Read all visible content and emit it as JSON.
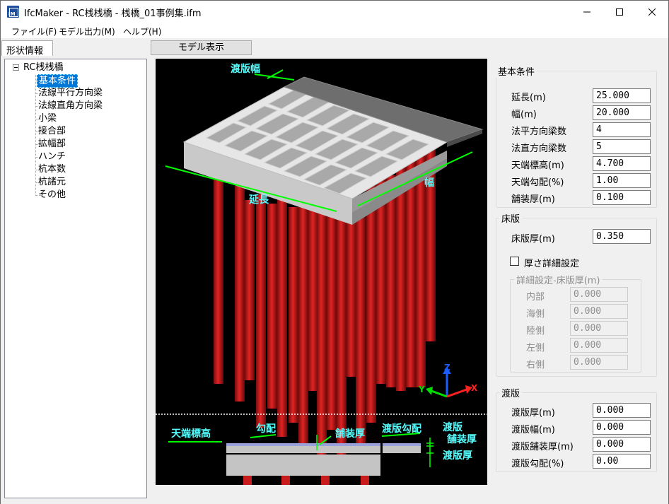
{
  "window": {
    "title": "IfcMaker - RC桟桟橋 - 桟橋_01事例集.ifm",
    "icon": "ifc-app-icon",
    "icon_text": "IM"
  },
  "menu": [
    "ファイル(F)",
    "モデル出力(M)",
    "ヘルプ(H)"
  ],
  "left_tab": "形状情報",
  "center_tab": "モデル表示",
  "tree": {
    "root": "RC桟桟橋",
    "items": [
      "基本条件",
      "法線平行方向梁",
      "法線直角方向梁",
      "小梁",
      "接合部",
      "拡幅部",
      "ハンチ",
      "杭本数",
      "杭諸元",
      "その他"
    ],
    "selected_index": 0
  },
  "viewport": {
    "labels": {
      "approach_width": "渡版幅",
      "width": "幅",
      "length": "延長",
      "top_elevation": "天端標高",
      "slope": "勾配",
      "pavement": "舗装厚",
      "approach_slope": "渡版勾配",
      "approach_pavement_1": "渡版",
      "approach_pavement_2": "舗装厚",
      "approach_thickness": "渡版厚"
    },
    "axes": {
      "x": "X",
      "y": "Y",
      "z": "Z"
    },
    "colors": {
      "dim": "#00ff00",
      "label": "#55ffff",
      "pile": "#d21a1a",
      "deck": "#c8c8c8"
    }
  },
  "basic": {
    "title": "基本条件",
    "rows": [
      {
        "label": "延長(m)",
        "value": "25.000"
      },
      {
        "label": "幅(m)",
        "value": "20.000"
      },
      {
        "label": "法平方向梁数",
        "value": "4"
      },
      {
        "label": "法直方向梁数",
        "value": "5"
      },
      {
        "label": "天端標高(m)",
        "value": "4.700"
      },
      {
        "label": "天端勾配(%)",
        "value": "1.00"
      },
      {
        "label": "舗装厚(m)",
        "value": "0.100"
      }
    ]
  },
  "slab": {
    "title": "床版",
    "thickness_label": "床版厚(m)",
    "thickness_value": "0.350",
    "checkbox_label": "厚さ詳細設定",
    "detail_title": "詳細設定-床版厚(m)",
    "detail_rows": [
      {
        "label": "内部",
        "value": "0.000"
      },
      {
        "label": "海側",
        "value": "0.000"
      },
      {
        "label": "陸側",
        "value": "0.000"
      },
      {
        "label": "左側",
        "value": "0.000"
      },
      {
        "label": "右側",
        "value": "0.000"
      }
    ]
  },
  "approach": {
    "title": "渡版",
    "rows": [
      {
        "label": "渡版厚(m)",
        "value": "0.000"
      },
      {
        "label": "渡版幅(m)",
        "value": "0.000"
      },
      {
        "label": "渡版舗装厚(m)",
        "value": "0.000"
      },
      {
        "label": "渡版勾配(%)",
        "value": "0.00"
      }
    ]
  }
}
